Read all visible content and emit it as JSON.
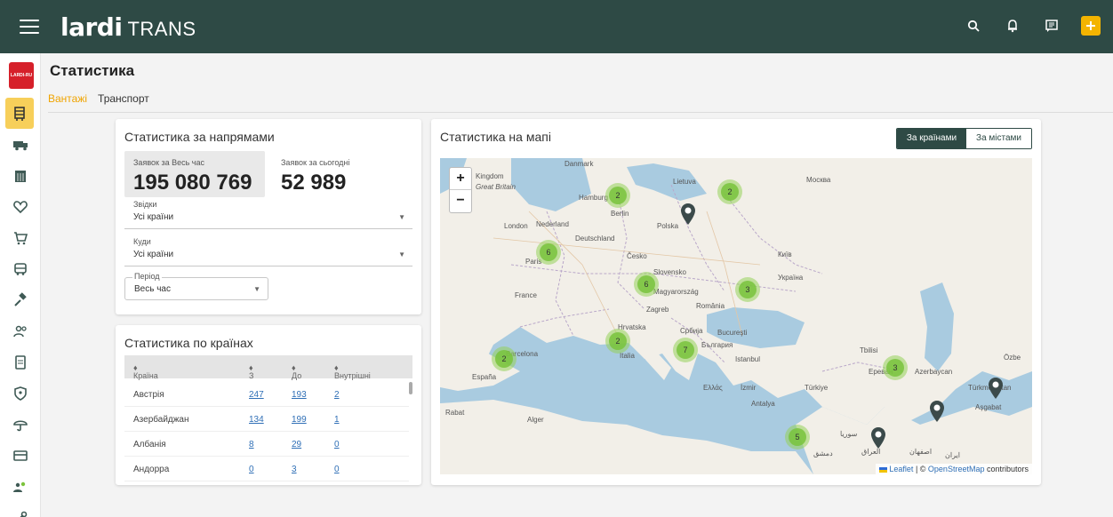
{
  "app": {
    "logo_main": "lardi",
    "logo_sub": "TRANS",
    "brand_badge": "LARDI-RU"
  },
  "page": {
    "title": "Статистика",
    "tabs": [
      "Вантажі",
      "Транспорт"
    ]
  },
  "directions": {
    "title": "Статистика за напрямами",
    "total_label": "Заявок за Весь час",
    "total_value": "195 080 769",
    "today_label": "Заявок за сьогодні",
    "today_value": "52 989",
    "from_label": "Звідки",
    "from_value": "Усі країни",
    "to_label": "Куди",
    "to_value": "Усі країни",
    "period_label": "Період",
    "period_value": "Весь час"
  },
  "countries": {
    "title": "Статистика по країнах",
    "headers": [
      "Країна",
      "З",
      "До",
      "Внутрішні"
    ],
    "rows": [
      {
        "name": "Австрія",
        "from": "247",
        "to": "193",
        "inner": "2"
      },
      {
        "name": "Азербайджан",
        "from": "134",
        "to": "199",
        "inner": "1"
      },
      {
        "name": "Албанія",
        "from": "8",
        "to": "29",
        "inner": "0"
      },
      {
        "name": "Андорра",
        "from": "0",
        "to": "3",
        "inner": "0"
      }
    ]
  },
  "map": {
    "title": "Статистика на мапі",
    "toggle_on": "За країнами",
    "toggle_off": "За містами",
    "zoom_in": "+",
    "zoom_out": "−",
    "clusters": [
      "2",
      "2",
      "6",
      "6",
      "3",
      "2",
      "7",
      "2",
      "3",
      "5"
    ],
    "places": [
      "Danmark",
      "Kingdom",
      "Great Britain",
      "Hamburg",
      "Berlin",
      "Lietuva",
      "Москва",
      "Polska",
      "London",
      "Nederland",
      "Deutschland",
      "Paris",
      "Česko",
      "Київ",
      "Slovensko",
      "Україна",
      "France",
      "Magyarország",
      "Zagreb",
      "România",
      "Hrvatska",
      "Bucureşti",
      "Србија",
      "България",
      "Barcelona",
      "Italia",
      "Istanbul",
      "España",
      "Ελλάς",
      "İzmir",
      "Türkiye",
      "Antalya",
      "Rabat",
      "Alger",
      "سوريا",
      "دمشق",
      "العراق",
      "اصفهان",
      "ایران",
      "Türkmenistan",
      "Aşgabat",
      "Özbe",
      "Ереван",
      "Tbilisi",
      "Azerbaycan"
    ],
    "attribution_leaflet": "Leaflet",
    "attribution_sep": " | © ",
    "attribution_osm": "OpenStreetMap",
    "attribution_tail": " contributors"
  },
  "colors": {
    "header": "#2e4a45",
    "accent": "#f0a400",
    "cluster": "#7cc33c",
    "link": "#2f6fb6"
  },
  "icons": {
    "top": [
      "search-icon",
      "bell-icon",
      "message-icon",
      "add-icon"
    ],
    "sidebar": [
      "cargo-icon",
      "truck-icon",
      "calendar-icon",
      "heart-icon",
      "cart-icon",
      "bus-icon",
      "hammer-icon",
      "users-icon",
      "document-icon",
      "shield-icon",
      "umbrella-icon",
      "card-icon",
      "people-icon",
      "tools-icon"
    ]
  }
}
